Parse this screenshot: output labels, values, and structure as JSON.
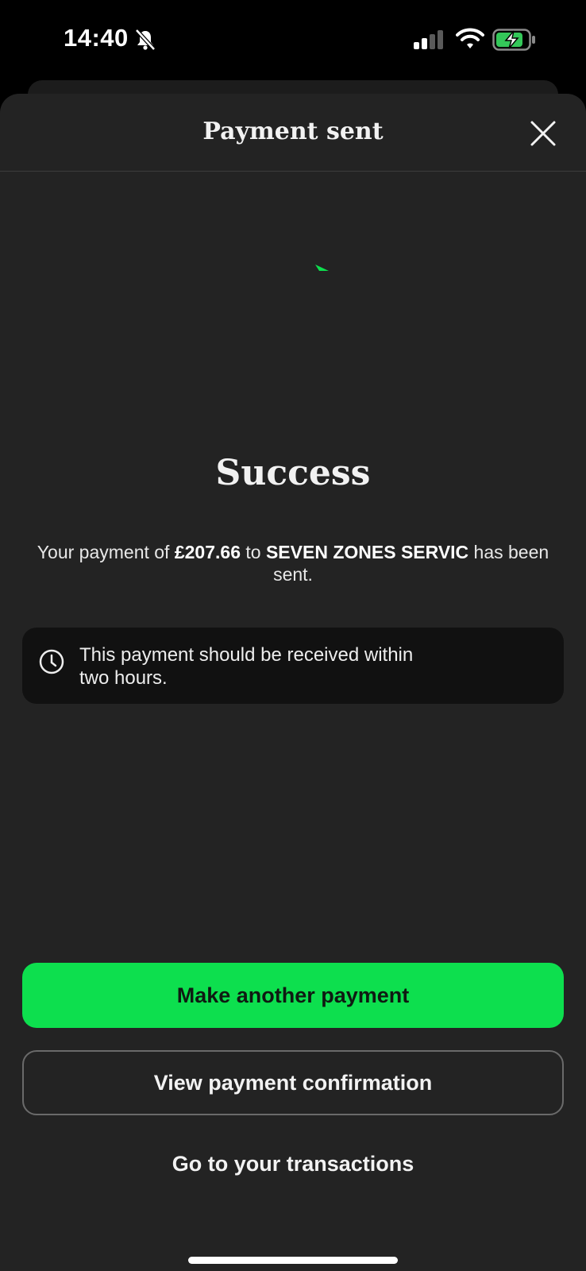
{
  "status_bar": {
    "time": "14:40"
  },
  "header": {
    "title": "Payment sent"
  },
  "main": {
    "heading": "Success",
    "message": {
      "prefix": "Your payment of ",
      "amount": "£207.66",
      "middle": " to ",
      "recipient": "SEVEN ZONES SERVIC",
      "suffix": " has been sent."
    },
    "info": {
      "line1": "This payment should be received within",
      "line2": "two hours."
    }
  },
  "actions": {
    "primary_label": "Make another payment",
    "secondary_label": "View payment confirmation",
    "link_label": "Go to your transactions"
  },
  "colors": {
    "accent_green": "#0ddf4e",
    "sheet_background": "#232323",
    "info_background": "#111111"
  },
  "icons": [
    "bell-muted-icon",
    "signal-icon",
    "wifi-icon",
    "battery-charging-icon",
    "close-icon",
    "loading-spinner-icon",
    "clock-icon"
  ]
}
